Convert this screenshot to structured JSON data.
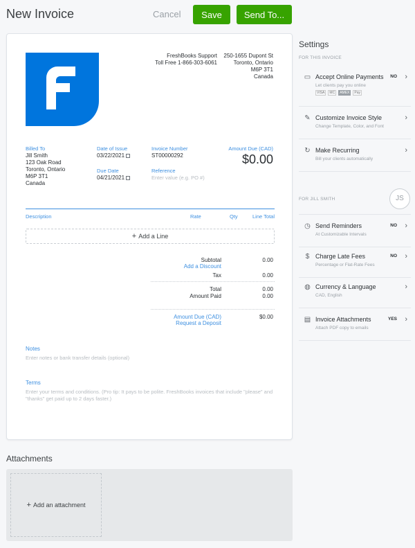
{
  "header": {
    "title": "New Invoice",
    "cancel_label": "Cancel",
    "save_label": "Save",
    "send_label": "Send To..."
  },
  "invoice": {
    "company_name": "FreshBooks Support",
    "company_phone": "Toll Free 1-866-303-6061",
    "address": [
      "250-1655 Dupont St",
      "Toronto, Ontario",
      "M6P 3T1",
      "Canada"
    ],
    "billed_to": {
      "label": "Billed To",
      "lines": [
        "Jill Smith",
        "123 Oak Road",
        "Toronto, Ontario",
        "M6P 3T1",
        "Canada"
      ]
    },
    "date_of_issue": {
      "label": "Date of Issue",
      "value": "03/22/2021"
    },
    "due_date": {
      "label": "Due Date",
      "value": "04/21/2021"
    },
    "invoice_number": {
      "label": "Invoice Number",
      "value": "ST00000292"
    },
    "reference": {
      "label": "Reference",
      "placeholder": "Enter value (e.g. PO #)"
    },
    "amount_due": {
      "label": "Amount Due (CAD)",
      "value": "$0.00"
    },
    "columns": [
      "Description",
      "Rate",
      "Qty",
      "Line Total"
    ],
    "add_line_label": "Add a Line",
    "totals": {
      "subtotal_label": "Subtotal",
      "subtotal": "0.00",
      "discount_label": "Add a Discount",
      "tax_label": "Tax",
      "tax": "0.00",
      "total_label": "Total",
      "total": "0.00",
      "paid_label": "Amount Paid",
      "paid": "0.00",
      "due_label": "Amount Due (CAD)",
      "due": "$0.00",
      "deposit_label": "Request a Deposit"
    },
    "notes": {
      "label": "Notes",
      "placeholder": "Enter notes or bank transfer details (optional)"
    },
    "terms": {
      "label": "Terms",
      "placeholder": "Enter your terms and conditions. (Pro tip: It pays to be polite. FreshBooks invoices that include \"please\" and \"thanks\" get paid up to 2 days faster.)"
    }
  },
  "attachments": {
    "title": "Attachments",
    "add_label": "Add an attachment"
  },
  "settings": {
    "title": "Settings",
    "group_invoice": "For This Invoice",
    "group_client": "For Jill Smith",
    "avatar_initials": "JS",
    "items": [
      {
        "title": "Accept Online Payments",
        "sub": "Let clients pay you online",
        "status": "NO",
        "icon": "payment-icon"
      },
      {
        "title": "Customize Invoice Style",
        "sub": "Change Template, Color, and Font",
        "status": "",
        "icon": "brush-icon"
      },
      {
        "title": "Make Recurring",
        "sub": "Bill your clients automatically",
        "status": "",
        "icon": "recurring-icon"
      },
      {
        "title": "Send Reminders",
        "sub": "At Customizable Intervals",
        "status": "NO",
        "icon": "clock-icon"
      },
      {
        "title": "Charge Late Fees",
        "sub": "Percentage or Flat-Rate Fees",
        "status": "NO",
        "icon": "dollar-icon"
      },
      {
        "title": "Currency & Language",
        "sub": "CAD, English",
        "status": "",
        "icon": "globe-icon"
      },
      {
        "title": "Invoice Attachments",
        "sub": "Attach PDF copy to emails",
        "status": "YES",
        "icon": "attachment-icon"
      }
    ],
    "pay_logos": [
      "VISA",
      "MC",
      "AMEX",
      "Pay"
    ]
  },
  "colors": {
    "accent": "#37a300",
    "link": "#3d8fe0",
    "logo": "#0075dd"
  }
}
